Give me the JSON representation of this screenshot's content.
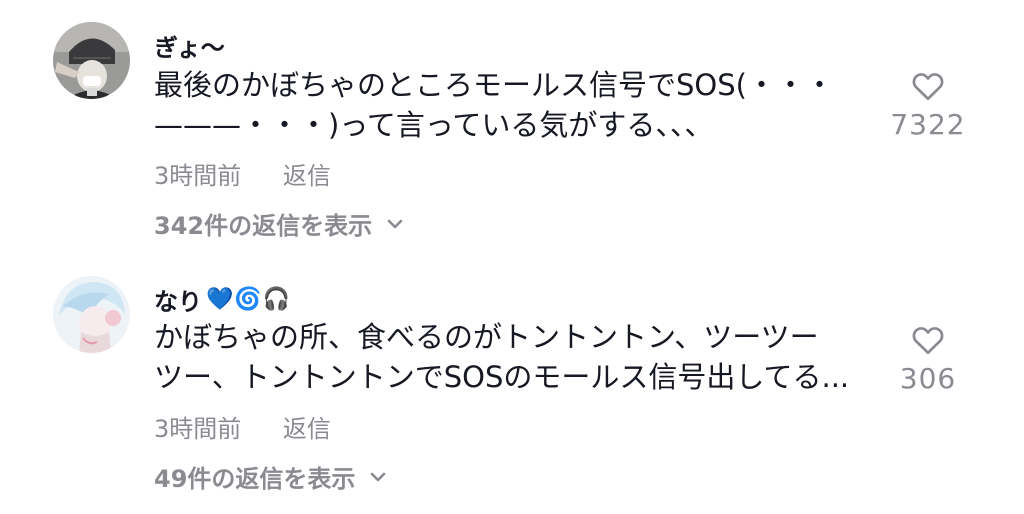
{
  "comments": [
    {
      "username": "ぎょ〜",
      "username_emojis": "",
      "text_line1": "最後のかぼちゃのところモールス信号でSOS(・・・",
      "text_line2": "———・・・)って言っている気がする、、、",
      "time": "3時間前",
      "reply_label": "返信",
      "view_replies": "342件の返信を表示",
      "likes": "7322"
    },
    {
      "username": "なり",
      "username_emojis": "💙🌀🎧",
      "text_line1": "かぼちゃの所、食べるのがトントントン、ツーツー",
      "text_line2": "ツー、トントントンでSOSのモールス信号出してる...",
      "time": "3時間前",
      "reply_label": "返信",
      "view_replies": "49件の返信を表示",
      "likes": "306"
    }
  ],
  "colors": {
    "text": "#161823",
    "secondary": "#8a8b91",
    "background": "#ffffff"
  },
  "icons": {
    "like": "heart-outline-icon",
    "expand": "chevron-down-icon"
  }
}
